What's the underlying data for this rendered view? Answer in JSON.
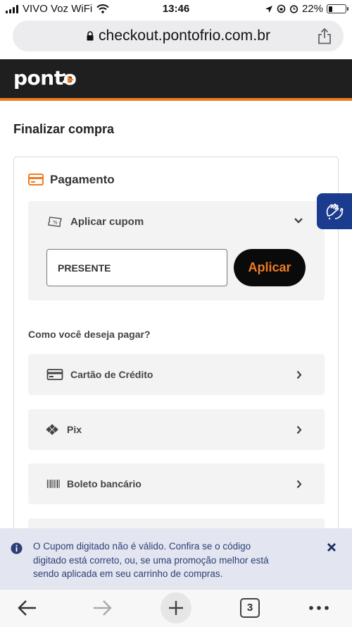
{
  "status_bar": {
    "carrier": "VIVO Voz WiFi",
    "time": "13:46",
    "battery": "22%",
    "battery_level": 0.22
  },
  "browser": {
    "url": "checkout.pontofrio.com.br",
    "tabs_count": "3"
  },
  "header": {
    "logo": "ponto"
  },
  "page": {
    "title": "Finalizar compra"
  },
  "payment": {
    "section_title": "Pagamento",
    "coupon": {
      "label": "Aplicar cupom",
      "value": "PRESENTE",
      "apply_label": "Aplicar"
    },
    "question": "Como você deseja pagar?",
    "options": [
      {
        "label": "Cartão de Crédito",
        "icon": "credit-card-icon"
      },
      {
        "label": "Pix",
        "icon": "pix-icon"
      },
      {
        "label": "Boleto bancário",
        "icon": "barcode-icon"
      }
    ]
  },
  "toast": {
    "message": "O Cupom digitado não é válido. Confira se o código digitado está correto, ou, se uma promoção melhor está sendo aplicada em seu carrinho de compras."
  },
  "colors": {
    "accent": "#f07c22",
    "header_bg": "#1f1f1f",
    "toast_bg": "#e3e6f0",
    "toast_text": "#2c3e75",
    "a11y_blue": "#1b3b8f"
  }
}
